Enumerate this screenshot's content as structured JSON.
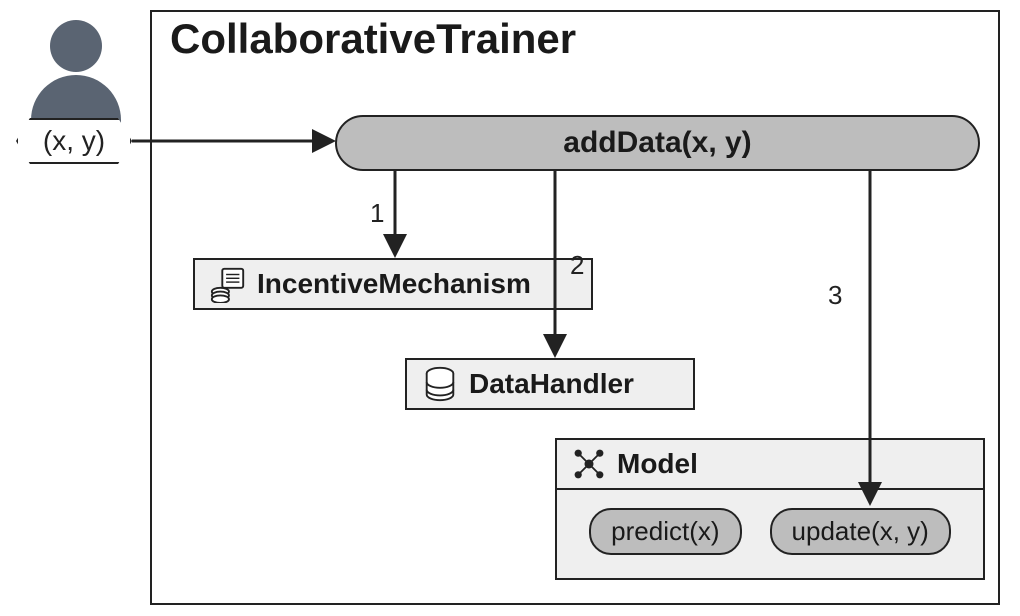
{
  "title": "CollaborativeTrainer",
  "user_input": "(x, y)",
  "method": "addData(x, y)",
  "components": {
    "incentive": "IncentiveMechanism",
    "datahandler": "DataHandler",
    "model": "Model"
  },
  "model_methods": {
    "predict": "predict(x)",
    "update": "update(x, y)"
  },
  "arrows": {
    "a1": "1",
    "a2": "2",
    "a3": "3"
  }
}
